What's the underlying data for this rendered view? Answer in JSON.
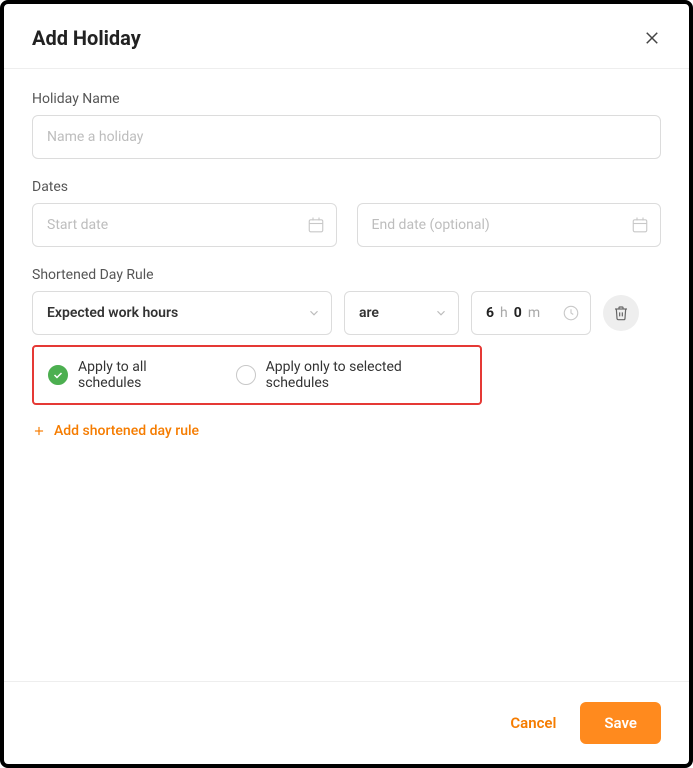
{
  "header": {
    "title": "Add Holiday"
  },
  "fields": {
    "holiday_name_label": "Holiday Name",
    "holiday_name_placeholder": "Name a holiday",
    "dates_label": "Dates",
    "start_date_placeholder": "Start date",
    "end_date_placeholder": "End date (optional)"
  },
  "rule": {
    "label": "Shortened Day Rule",
    "attribute_select": "Expected work hours",
    "operator_select": "are",
    "hours_value": "6",
    "hours_unit": "h",
    "mins_value": "0",
    "mins_unit": "m"
  },
  "radios": {
    "apply_all": "Apply to all schedules",
    "apply_selected": "Apply only to selected schedules"
  },
  "add_rule_label": "Add shortened day rule",
  "footer": {
    "cancel": "Cancel",
    "save": "Save"
  },
  "colors": {
    "accent": "#ff8a1e",
    "link": "#f57c00",
    "success": "#4caf50",
    "highlight_border": "#e53935"
  }
}
